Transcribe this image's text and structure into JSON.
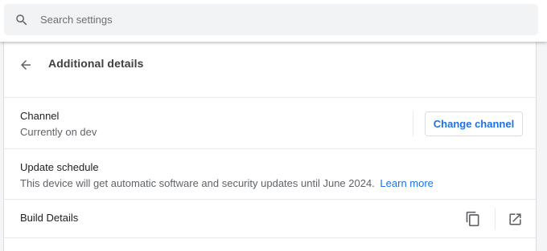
{
  "search": {
    "placeholder": "Search settings",
    "value": ""
  },
  "page": {
    "title": "Additional details"
  },
  "channel": {
    "title": "Channel",
    "subtitle": "Currently on dev",
    "button_label": "Change channel"
  },
  "update_schedule": {
    "title": "Update schedule",
    "description": "This device will get automatic software and security updates until June 2024.",
    "link_label": "Learn more"
  },
  "build_details": {
    "title": "Build Details"
  },
  "icons": {
    "search": "search-icon",
    "back": "arrow-back-icon",
    "copy": "copy-icon",
    "open_external": "open-in-new-icon"
  },
  "colors": {
    "accent": "#1a73e8",
    "text_primary": "#202124",
    "text_secondary": "#5f6368",
    "search_bg": "#f1f3f4",
    "divider": "#e8eaed"
  }
}
